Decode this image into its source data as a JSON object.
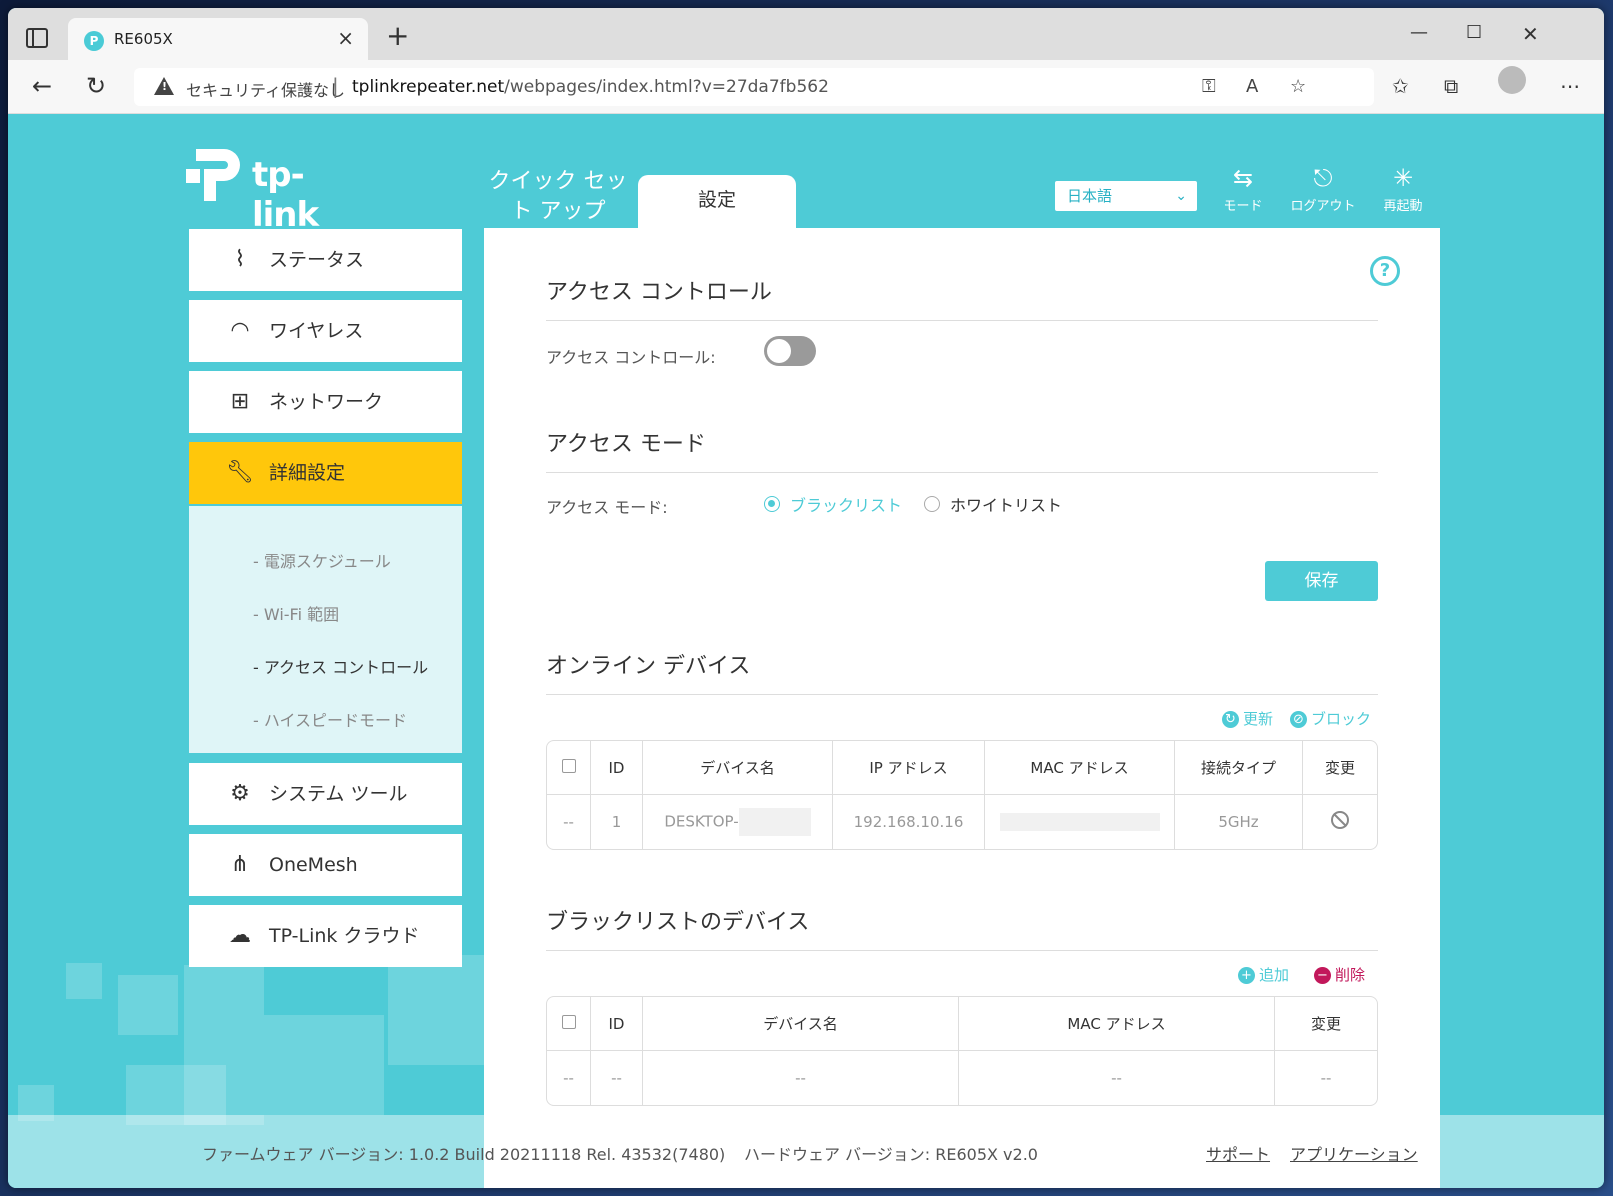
{
  "browser": {
    "tab_title": "RE605X",
    "security_text": "セキュリティ保護なし",
    "url_host": "tplinkrepeater.net",
    "url_path": "/webpages/index.html?v=27da7fb562"
  },
  "header": {
    "logo_text": "tp-link",
    "tab_quick_setup": "クイック セット アップ",
    "tab_settings": "設定",
    "language": "日本語",
    "mode_label": "モード",
    "logout_label": "ログアウト",
    "reboot_label": "再起動"
  },
  "sidebar": {
    "items": [
      {
        "label": "ステータス",
        "icon": "pulse-icon"
      },
      {
        "label": "ワイヤレス",
        "icon": "wifi-icon"
      },
      {
        "label": "ネットワーク",
        "icon": "network-icon"
      },
      {
        "label": "詳細設定",
        "icon": "wrench-icon"
      },
      {
        "label": "システム ツール",
        "icon": "gear-icon"
      },
      {
        "label": "OneMesh",
        "icon": "mesh-icon"
      },
      {
        "label": "TP-Link クラウド",
        "icon": "cloud-icon"
      }
    ],
    "sub_items": [
      "- 電源スケジュール",
      "- Wi-Fi 範囲",
      "- アクセス コントロール",
      "- ハイスピードモード"
    ]
  },
  "main": {
    "access_control_title": "アクセス コントロール",
    "access_control_label": "アクセス コントロール:",
    "access_control_enabled": false,
    "access_mode_title": "アクセス モード",
    "access_mode_label": "アクセス モード:",
    "mode_blacklist": "ブラックリスト",
    "mode_whitelist": "ホワイトリスト",
    "selected_mode": "blacklist",
    "save_label": "保存",
    "online_title": "オンライン デバイス",
    "refresh_label": "更新",
    "block_label": "ブロック",
    "online_table": {
      "headers": [
        "ID",
        "デバイス名",
        "IP アドレス",
        "MAC アドレス",
        "接続タイプ",
        "変更"
      ],
      "row": {
        "check": "--",
        "id": "1",
        "name": "DESKTOP-",
        "ip": "192.168.10.16",
        "type": "5GHz"
      }
    },
    "blacklist_title": "ブラックリストのデバイス",
    "add_label": "追加",
    "delete_label": "削除",
    "blacklist_table": {
      "headers": [
        "ID",
        "デバイス名",
        "MAC アドレス",
        "変更"
      ],
      "row": [
        "--",
        "--",
        "--",
        "--",
        "--"
      ]
    }
  },
  "footer": {
    "firmware": "ファームウェア バージョン: 1.0.2 Build 20211118 Rel. 43532(7480)",
    "hardware": "ハードウェア バージョン: RE605X v2.0",
    "support": "サポート",
    "app": "アプリケーション"
  },
  "colors": {
    "accent": "#4ecbd6",
    "active": "#ffc70b",
    "delete": "#c2185b"
  }
}
